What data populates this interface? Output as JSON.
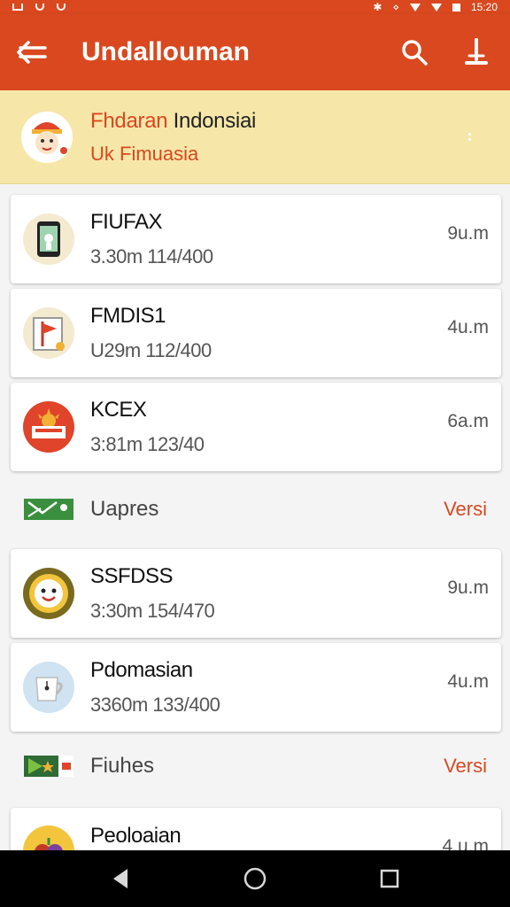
{
  "status_bar": {
    "time": "15:20"
  },
  "app_bar": {
    "title": "Undallouman"
  },
  "banner": {
    "title_accent": "Fhdaran",
    "title_rest": " Indonsiai",
    "subtitle": "Uk Fimuasia"
  },
  "cards": [
    {
      "title": "FIUFAX",
      "subtitle": "3.30m 114/400",
      "time": "9u.m",
      "icon": "phone-icon"
    },
    {
      "title": "FMDIS1",
      "subtitle": "U29m 112/400",
      "time": "4u.m",
      "icon": "flag-board-icon"
    },
    {
      "title": "KCEX",
      "subtitle": "3:81m 123/40",
      "time": "6a.m",
      "icon": "sun-sign-icon"
    }
  ],
  "sections": [
    {
      "label": "Uapres",
      "action": "Versi",
      "icon": "envelope-green-icon"
    },
    {
      "label": "Fiuhes",
      "action": "Versi",
      "icon": "flag-green-icon"
    }
  ],
  "cards2": [
    {
      "title": "SSFDSS",
      "subtitle": "3:30m 154/470",
      "time": "9u.m",
      "icon": "smiley-icon"
    },
    {
      "title": "Pdomasian",
      "subtitle": "3360m 133/400",
      "time": "4u.m",
      "icon": "mug-icon"
    }
  ],
  "partial_card": {
    "title": "Peoloaian",
    "time": "4.u.m",
    "icon": "fruit-icon"
  },
  "colors": {
    "primary": "#d9481f",
    "banner": "#f6e7a9",
    "nav": "#000000"
  }
}
